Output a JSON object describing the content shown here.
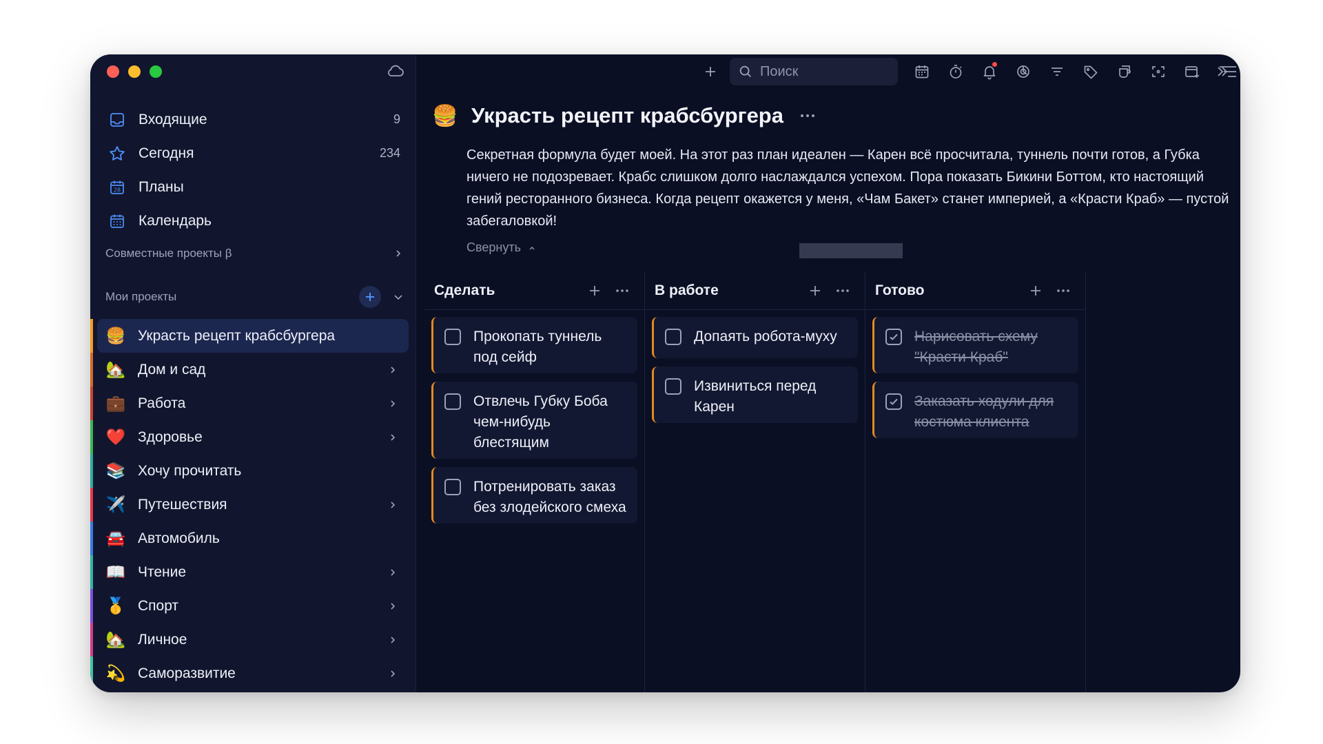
{
  "sidebar": {
    "nav": [
      {
        "label": "Входящие",
        "count": "9",
        "icon": "inbox-icon"
      },
      {
        "label": "Сегодня",
        "count": "234",
        "icon": "star-icon"
      },
      {
        "label": "Планы",
        "count": "",
        "icon": "plans-calendar-icon"
      },
      {
        "label": "Календарь",
        "count": "",
        "icon": "calendar-icon"
      }
    ],
    "shared_section": "Совместные проекты β",
    "my_projects_section": "Мои проекты",
    "projects": [
      {
        "emoji": "🍔",
        "label": "Украсть рецепт крабсбургера",
        "color": "#f39b1d",
        "active": true,
        "chevron": false
      },
      {
        "emoji": "🏡",
        "label": "Дом и сад",
        "color": "#d2682a",
        "active": false,
        "chevron": true
      },
      {
        "emoji": "💼",
        "label": "Работа",
        "color": "#c8452e",
        "active": false,
        "chevron": true
      },
      {
        "emoji": "❤️",
        "label": "Здоровье",
        "color": "#3cb554",
        "active": false,
        "chevron": true
      },
      {
        "emoji": "📚",
        "label": "Хочу прочитать",
        "color": "#30a8a0",
        "active": false,
        "chevron": false
      },
      {
        "emoji": "✈️",
        "label": "Путешествия",
        "color": "#e5354f",
        "active": false,
        "chevron": true
      },
      {
        "emoji": "🚘",
        "label": "Автомобиль",
        "color": "#3a7ae0",
        "active": false,
        "chevron": false
      },
      {
        "emoji": "📖",
        "label": "Чтение",
        "color": "#2fb2a8",
        "active": false,
        "chevron": true
      },
      {
        "emoji": "🥇",
        "label": "Спорт",
        "color": "#7a4fd6",
        "active": false,
        "chevron": true
      },
      {
        "emoji": "🏡",
        "label": "Личное",
        "color": "#d43a8c",
        "active": false,
        "chevron": true
      },
      {
        "emoji": "💫",
        "label": "Саморазвитие",
        "color": "#3ec3a0",
        "active": false,
        "chevron": true
      }
    ]
  },
  "toolbar": {
    "search_placeholder": "Поиск",
    "icons": [
      "plus-icon",
      "search-icon",
      "calendar-icon",
      "timer-icon",
      "bell-icon",
      "focus-icon",
      "filter-icon",
      "tag-icon",
      "cup-icon",
      "screenshot-icon",
      "add-window-icon",
      "expand-icon"
    ]
  },
  "project": {
    "emoji": "🍔",
    "title": "Украсть рецепт крабсбургера",
    "description": "Секретная формула будет моей. На этот раз план идеален — Карен всё просчитала, туннель почти готов, а Губка ничего не подозревает. Крабс слишком долго наслаждался успехом. Пора показать Бикини Боттом, кто настоящий гений ресторанного бизнеса. Когда рецепт окажется у меня, «Чам Бакет» станет империей, а «Красти Краб» — пустой забегаловкой!",
    "collapse_label": "Свернуть"
  },
  "board": {
    "columns": [
      {
        "title": "Сделать",
        "cards": [
          {
            "text": "Прокопать туннель под сейф",
            "done": false
          },
          {
            "text": "Отвлечь Губку Боба чем-нибудь блестящим",
            "done": false
          },
          {
            "text": "Потренировать заказ без злодейского смеха",
            "done": false
          }
        ]
      },
      {
        "title": "В работе",
        "cards": [
          {
            "text": "Допаять робота-муху",
            "done": false
          },
          {
            "text": "Извиниться перед Карен",
            "done": false
          }
        ]
      },
      {
        "title": "Готово",
        "cards": [
          {
            "text": "Нарисовать схему \"Красти Краб\"",
            "done": true
          },
          {
            "text": "Заказать ходули для костюма клиента",
            "done": true
          }
        ]
      }
    ],
    "accent_color": "#e48a1f"
  }
}
